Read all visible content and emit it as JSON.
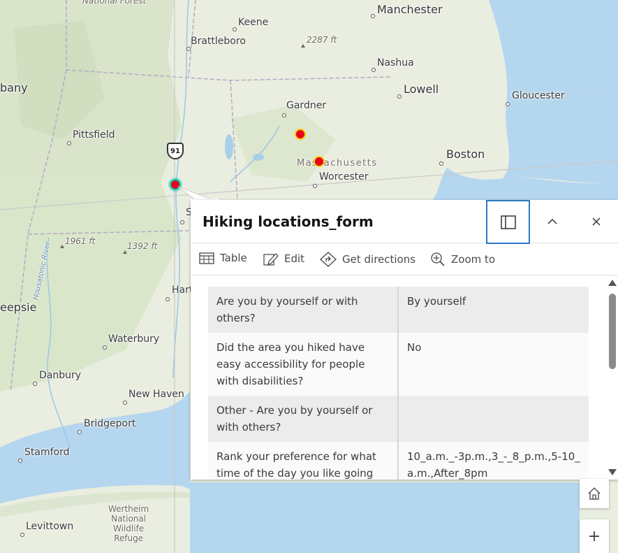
{
  "map": {
    "labels": {
      "national_forest": "National Forest",
      "manchester": "Manchester",
      "keene": "Keene",
      "brattleboro": "Brattleboro",
      "elev_2287": "2287 ft",
      "nashua": "Nashua",
      "lowell": "Lowell",
      "albany_partial": "bany",
      "gloucester": "Gloucester",
      "gardner": "Gardner",
      "pittsfield": "Pittsfield",
      "massachusetts": "Massachusetts",
      "boston": "Boston",
      "worcester": "Worcester",
      "elev_1961": "1961 ft",
      "elev_1392": "1392 ft",
      "housatonic": "Housatonic River",
      "springfield_partial": "S",
      "hartford_partial": "Hart",
      "poughkeepsie_partial": "eepsie",
      "waterbury": "Waterbury",
      "danbury": "Danbury",
      "new_haven": "New Haven",
      "bridgeport": "Bridgeport",
      "stamford": "Stamford",
      "wertheim": "Wertheim\nNational\nWildlife\nRefuge",
      "levittown": "Levittown"
    },
    "highway_shield": "91",
    "colors": {
      "water": "#b5d6ef",
      "land": "#e9eee0",
      "forest": "#d6e2c6",
      "marker_fill": "#e8001c",
      "marker_ring": "#f5d000",
      "marker_selected_ring": "#00d9b5",
      "accent": "#2c79c4"
    }
  },
  "popup": {
    "title": "Hiking locations_form",
    "buttons": {
      "dock_icon": "dock-icon",
      "collapse_icon": "chevron-up-icon",
      "close_icon": "close-icon"
    },
    "actions": [
      {
        "label": "Table",
        "icon": "table-icon"
      },
      {
        "label": "Edit",
        "icon": "pencil-icon"
      },
      {
        "label": "Get directions",
        "icon": "directions-icon"
      },
      {
        "label": "Zoom to",
        "icon": "zoom-in-icon"
      }
    ],
    "rows": [
      {
        "label": "Are you by yourself or with others?",
        "value": "By yourself"
      },
      {
        "label": "Did the area you hiked have easy accessibility for people with disabilities?",
        "value": "No"
      },
      {
        "label": "Other - Are you by yourself or with others?",
        "value": ""
      },
      {
        "label": "Rank your preference for what time of the day you like going for",
        "value": "10_a.m._-3p.m.,3_-_8_p.m.,5-10_a.m.,After_8pm"
      }
    ]
  },
  "controls": {
    "home_icon": "home-icon",
    "zoom_in_symbol": "+"
  }
}
